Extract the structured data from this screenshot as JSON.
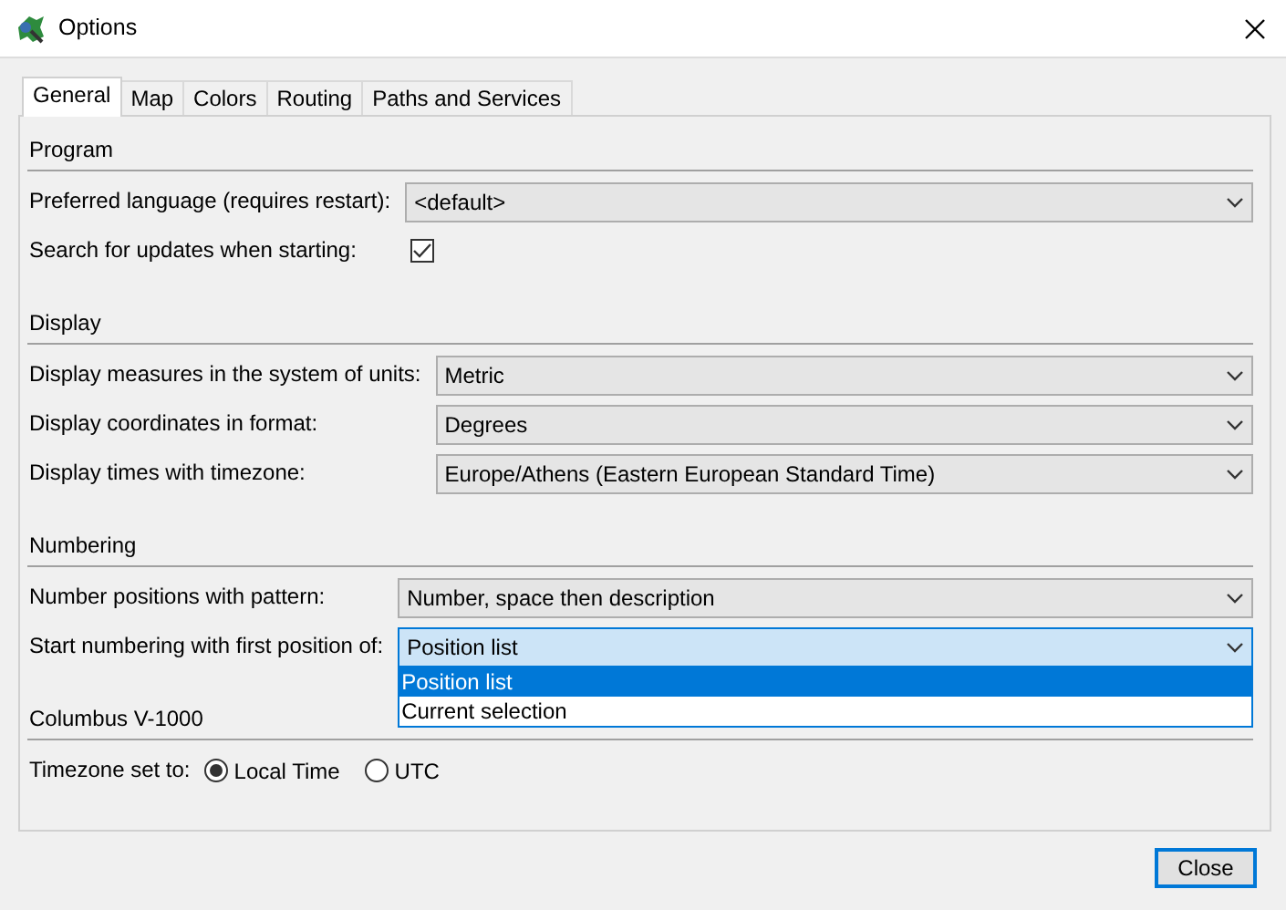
{
  "window": {
    "title": "Options"
  },
  "tabs": [
    {
      "label": "General",
      "selected": true
    },
    {
      "label": "Map",
      "selected": false
    },
    {
      "label": "Colors",
      "selected": false
    },
    {
      "label": "Routing",
      "selected": false
    },
    {
      "label": "Paths and Services",
      "selected": false
    }
  ],
  "sections": [
    {
      "title": "Program",
      "rows": [
        {
          "kind": "combo",
          "label": "Preferred language (requires restart):",
          "value": "<default>",
          "expanded": false
        },
        {
          "kind": "checkbox",
          "label": "Search for updates when starting:",
          "checked": true
        }
      ]
    },
    {
      "title": "Display",
      "rows": [
        {
          "kind": "combo",
          "label": "Display measures in the system of units:",
          "value": "Metric",
          "expanded": false
        },
        {
          "kind": "combo",
          "label": "Display coordinates in format:",
          "value": "Degrees",
          "expanded": false
        },
        {
          "kind": "combo",
          "label": "Display times with timezone:",
          "value": "Europe/Athens (Eastern European Standard Time)",
          "expanded": false
        }
      ]
    },
    {
      "title": "Numbering",
      "rows": [
        {
          "kind": "combo",
          "label": "Number positions with pattern:",
          "value": "Number, space then description",
          "expanded": false
        },
        {
          "kind": "combo",
          "label": "Start numbering with first position of:",
          "value": "Position list",
          "expanded": true,
          "options": [
            {
              "label": "Position list",
              "selected": true
            },
            {
              "label": "Current selection",
              "selected": false
            }
          ]
        }
      ]
    },
    {
      "title": "Columbus V-1000",
      "rows": [
        {
          "kind": "radio",
          "label": "Timezone set to:",
          "options": [
            {
              "label": "Local Time",
              "selected": true
            },
            {
              "label": "UTC",
              "selected": false
            }
          ]
        }
      ]
    }
  ],
  "buttons": [
    "Close"
  ]
}
